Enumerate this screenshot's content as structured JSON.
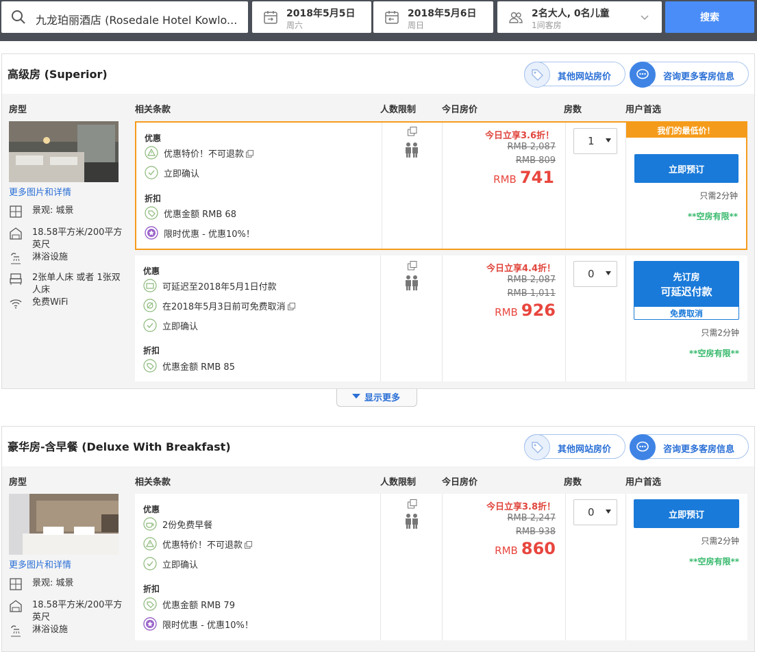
{
  "search": {
    "hotel": "九龙珀丽酒店 (Rosedale Hotel Kowlo...",
    "checkin_date": "2018年5月5日",
    "checkin_day": "周六",
    "checkout_date": "2018年5月6日",
    "checkout_day": "周日",
    "guests": "2名大人, 0名儿童",
    "rooms": "1间客房",
    "button": "搜索"
  },
  "columns": {
    "room_type": "房型",
    "terms": "相关条款",
    "capacity": "人数限制",
    "price": "今日房价",
    "rooms": "房数",
    "preferred": "用户首选"
  },
  "colors": {
    "accent_blue": "#1a7ad9",
    "orange": "#f59b1b",
    "price_red": "#e8463e",
    "green": "#37b96c"
  },
  "rooms": [
    {
      "title": "高级房 (Superior)",
      "other_prices": "其他网站房价",
      "consult": "咨询更多客房信息",
      "more_details": "更多图片和详情",
      "features": [
        {
          "icon": "window-icon",
          "text": "景观: 城景"
        },
        {
          "icon": "area-icon",
          "text": "18.58平方米/200平方英尺"
        },
        {
          "icon": "shower-icon",
          "text": "淋浴设施"
        },
        {
          "icon": "bed-icon",
          "text": "2张单人床 或者 1张双人床"
        },
        {
          "icon": "wifi-icon",
          "text": "免费WiFi"
        }
      ],
      "options": [
        {
          "best": true,
          "best_label": "我们的最低价！",
          "promo_heading": "优惠",
          "promo_terms": [
            "优惠特价！不可退款",
            "立即确认"
          ],
          "discount_heading": "折扣",
          "discount_terms": [
            "优惠金额 RMB 68",
            "限时优惠 - 优惠10%！"
          ],
          "sale_text": "今日立享3.6折！",
          "old_price_1": "RMB 2,087",
          "old_price_2": "RMB 809",
          "currency": "RMB",
          "price": "741",
          "quantity": "1",
          "book_label": "立即预订",
          "time_note": "只需2分钟",
          "availability": "**空房有限**"
        },
        {
          "best": false,
          "promo_heading": "优惠",
          "promo_terms": [
            "可延迟至2018年5月1日付款",
            "在2018年5月3日前可免费取消",
            "立即确认"
          ],
          "discount_heading": "折扣",
          "discount_terms": [
            "优惠金额 RMB 85"
          ],
          "sale_text": "今日立享4.4折！",
          "old_price_1": "RMB 2,087",
          "old_price_2": "RMB 1,011",
          "currency": "RMB",
          "price": "926",
          "quantity": "0",
          "book_label_1": "先订房",
          "book_label_2": "可延迟付款",
          "book_label_3": "免费取消",
          "time_note": "只需2分钟",
          "availability": "**空房有限**"
        }
      ],
      "show_more": "显示更多"
    },
    {
      "title": "豪华房-含早餐 (Deluxe With Breakfast)",
      "other_prices": "其他网站房价",
      "consult": "咨询更多客房信息",
      "more_details": "更多图片和详情",
      "features": [
        {
          "icon": "window-icon",
          "text": "景观: 城景"
        },
        {
          "icon": "area-icon",
          "text": "18.58平方米/200平方英尺"
        },
        {
          "icon": "shower-icon",
          "text": "淋浴设施"
        }
      ],
      "options": [
        {
          "best": false,
          "promo_heading": "优惠",
          "promo_terms": [
            "2份免费早餐",
            "优惠特价！不可退款",
            "立即确认"
          ],
          "discount_heading": "折扣",
          "discount_terms": [
            "优惠金额 RMB 79",
            "限时优惠 - 优惠10%！"
          ],
          "sale_text": "今日立享3.8折！",
          "old_price_1": "RMB 2,247",
          "old_price_2": "RMB 938",
          "currency": "RMB",
          "price": "860",
          "quantity": "0",
          "book_label": "立即预订",
          "time_note": "只需2分钟",
          "availability": "**空房有限**"
        }
      ]
    }
  ]
}
